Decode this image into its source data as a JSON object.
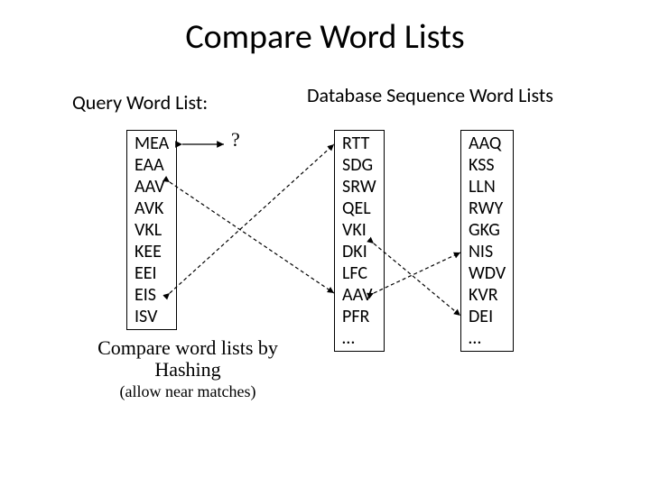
{
  "title": "Compare Word Lists",
  "query": {
    "label": "Query Word List:",
    "items": [
      "MEA",
      "EAA",
      "AAV",
      "AVK",
      "VKL",
      "KEE",
      "EEI",
      "EIS",
      "ISV"
    ]
  },
  "database": {
    "label": "Database Sequence Word Lists",
    "lists": [
      [
        "RTT",
        "SDG",
        "SRW",
        "QEL",
        "VKI",
        "DKI",
        "LFC",
        "AAV",
        "PFR",
        "…"
      ],
      [
        "AAQ",
        "KSS",
        "LLN",
        "RWY",
        "GKG",
        "NIS",
        "WDV",
        "KVR",
        "DEI",
        "…"
      ]
    ]
  },
  "question_mark": "?",
  "caption_main": "Compare word lists by Hashing",
  "caption_sub": "(allow near matches)"
}
